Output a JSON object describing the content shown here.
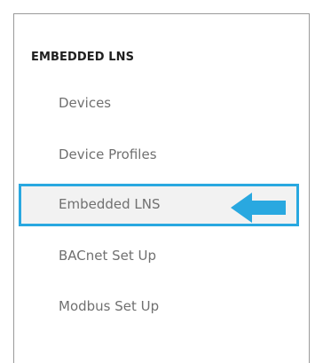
{
  "sidebar": {
    "section_title": "EMBEDDED LNS",
    "items": [
      {
        "label": "Devices"
      },
      {
        "label": "Device Profiles"
      },
      {
        "label": "Embedded LNS"
      },
      {
        "label": "BACnet Set Up"
      },
      {
        "label": "Modbus Set Up"
      }
    ],
    "active_index": 2,
    "active_border_color": "#29a8e0"
  },
  "annotation": {
    "arrow_icon": "left-arrow-icon",
    "color": "#29a8e0"
  }
}
